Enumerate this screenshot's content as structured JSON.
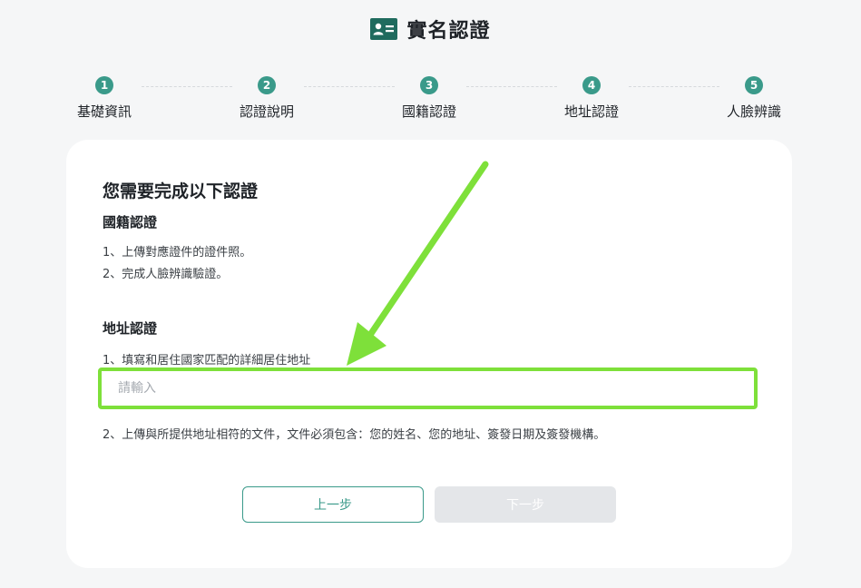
{
  "header": {
    "title": "實名認證",
    "icon": "id-card-icon"
  },
  "steps": [
    {
      "number": "1",
      "label": "基礎資訊"
    },
    {
      "number": "2",
      "label": "認證說明"
    },
    {
      "number": "3",
      "label": "國籍認證"
    },
    {
      "number": "4",
      "label": "地址認證"
    },
    {
      "number": "5",
      "label": "人臉辨識"
    }
  ],
  "card": {
    "title": "您需要完成以下認證",
    "nationality": {
      "title": "國籍認證",
      "items": [
        "1、上傳對應證件的證件照。",
        "2、完成人臉辨識驗證。"
      ]
    },
    "address": {
      "title": "地址認證",
      "item1": "1、填寫和居住國家匹配的詳細居住地址",
      "input_placeholder": "請輸入",
      "input_value": "",
      "item2": "2、上傳與所提供地址相符的文件，文件必須包含：您的姓名、您的地址、簽發日期及簽發機構。"
    },
    "buttons": {
      "prev": "上一步",
      "next": "下一步"
    }
  },
  "colors": {
    "accent": "#3a9a8a",
    "highlight": "#7ee03a",
    "disabled": "#e4e6e9",
    "background": "#f5f6f7"
  }
}
